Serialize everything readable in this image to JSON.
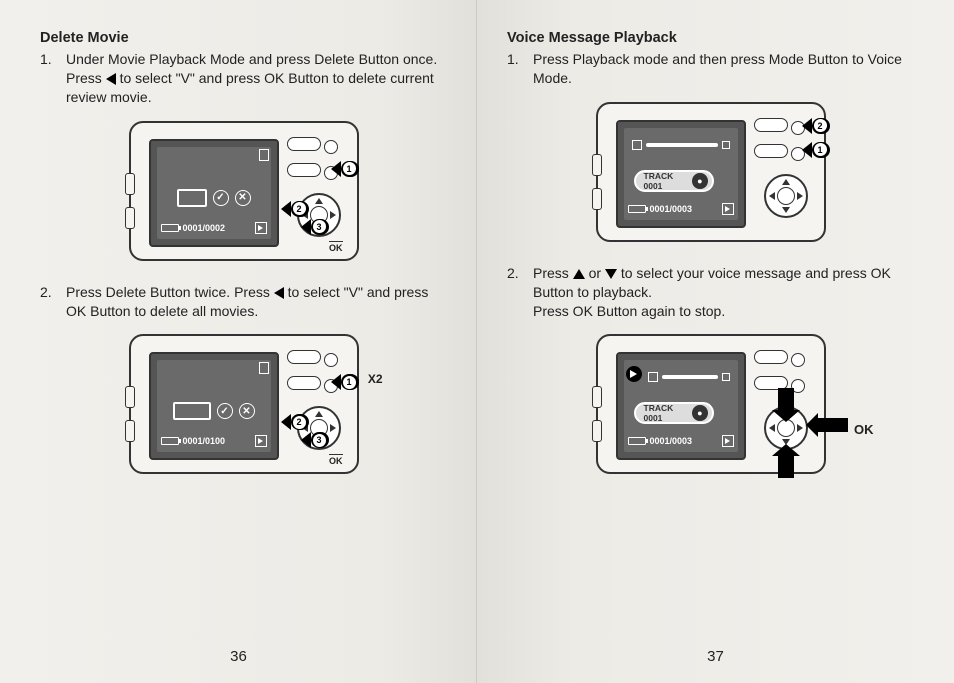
{
  "left": {
    "heading": "Delete Movie",
    "item1_num": "1.",
    "item1_text_a": "Under Movie Playback Mode and press Delete Button once. Press ",
    "item1_text_b": " to select \"V\" and press OK Button to delete current review movie.",
    "item2_num": "2.",
    "item2_text_a": "Press Delete Button twice. Press ",
    "item2_text_b": " to select \"V\" and press OK Button to delete all movies.",
    "fig1": {
      "counter": "0001/0002",
      "callout1": "1",
      "callout2": "2",
      "callout3": "3",
      "ok": "OK"
    },
    "fig2": {
      "counter": "0001/0100",
      "callout1": "1",
      "callout2": "2",
      "callout3": "3",
      "x2": "X2",
      "ok": "OK"
    },
    "pagenum": "36"
  },
  "right": {
    "heading": "Voice Message Playback",
    "item1_num": "1.",
    "item1_text": "Press Playback mode and then press Mode Button to Voice Mode.",
    "item2_num": "2.",
    "item2_text_a": "Press ",
    "item2_text_b": " or ",
    "item2_text_c": " to select your voice message and press OK Button to playback.",
    "item2_line2": "Press OK Button again to stop.",
    "fig1": {
      "track": "TRACK 0001",
      "counter": "0001/0003",
      "callout1": "1",
      "callout2": "2"
    },
    "fig2": {
      "track": "TRACK 0001",
      "counter": "0001/0003",
      "ok": "OK"
    },
    "pagenum": "37"
  }
}
